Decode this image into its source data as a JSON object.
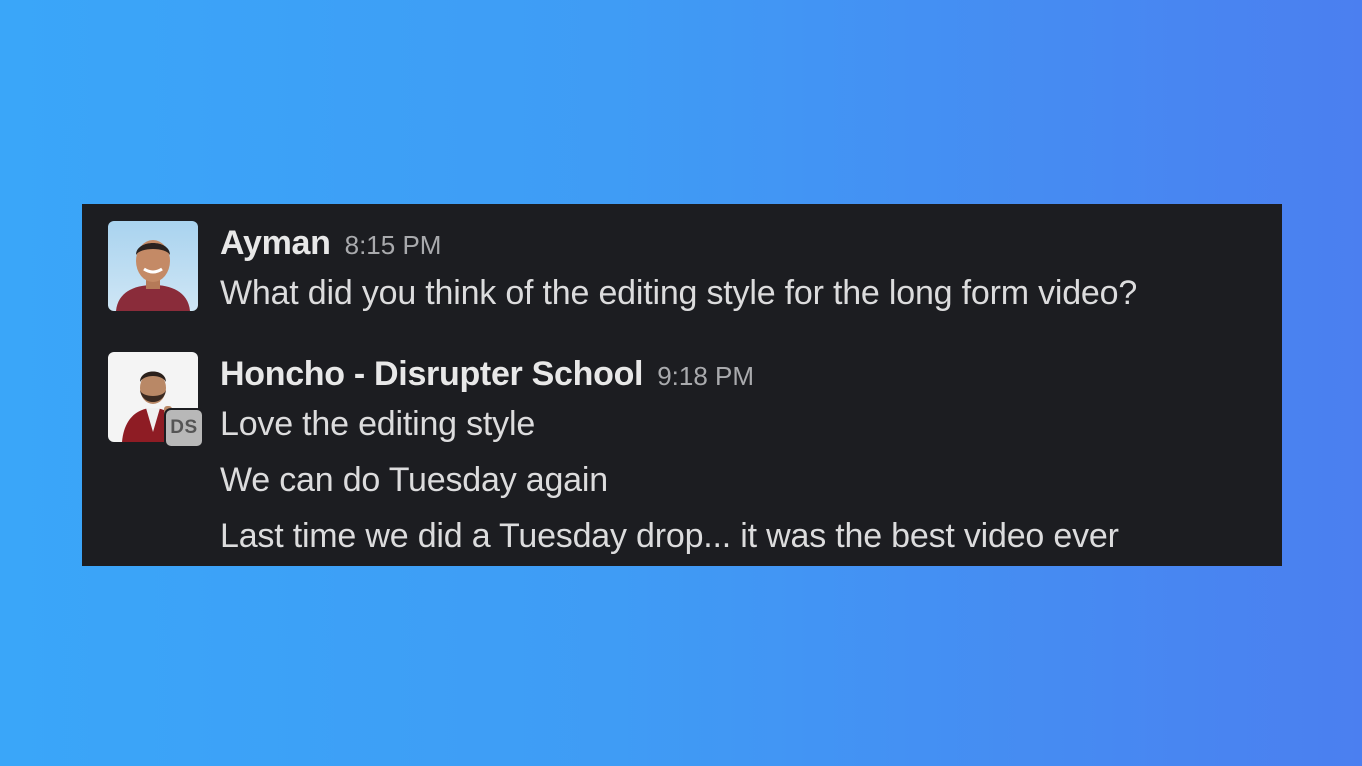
{
  "messages": [
    {
      "sender": "Ayman",
      "time": "8:15 PM",
      "lines": [
        "What did you think of the editing style for the long form video?"
      ]
    },
    {
      "sender": "Honcho - Disrupter School",
      "time": "9:18 PM",
      "badge": "DS",
      "lines": [
        "Love the editing style",
        "We can do Tuesday again",
        "Last time we did a Tuesday drop... it was the best video ever"
      ]
    }
  ],
  "colors": {
    "background_gradient_start": "#3aa6f9",
    "background_gradient_end": "#4b7ff0",
    "panel": "#1c1d21",
    "sender_text": "#e8e8e8",
    "timestamp_text": "#a9aaad",
    "message_text": "#dcdcdd"
  }
}
